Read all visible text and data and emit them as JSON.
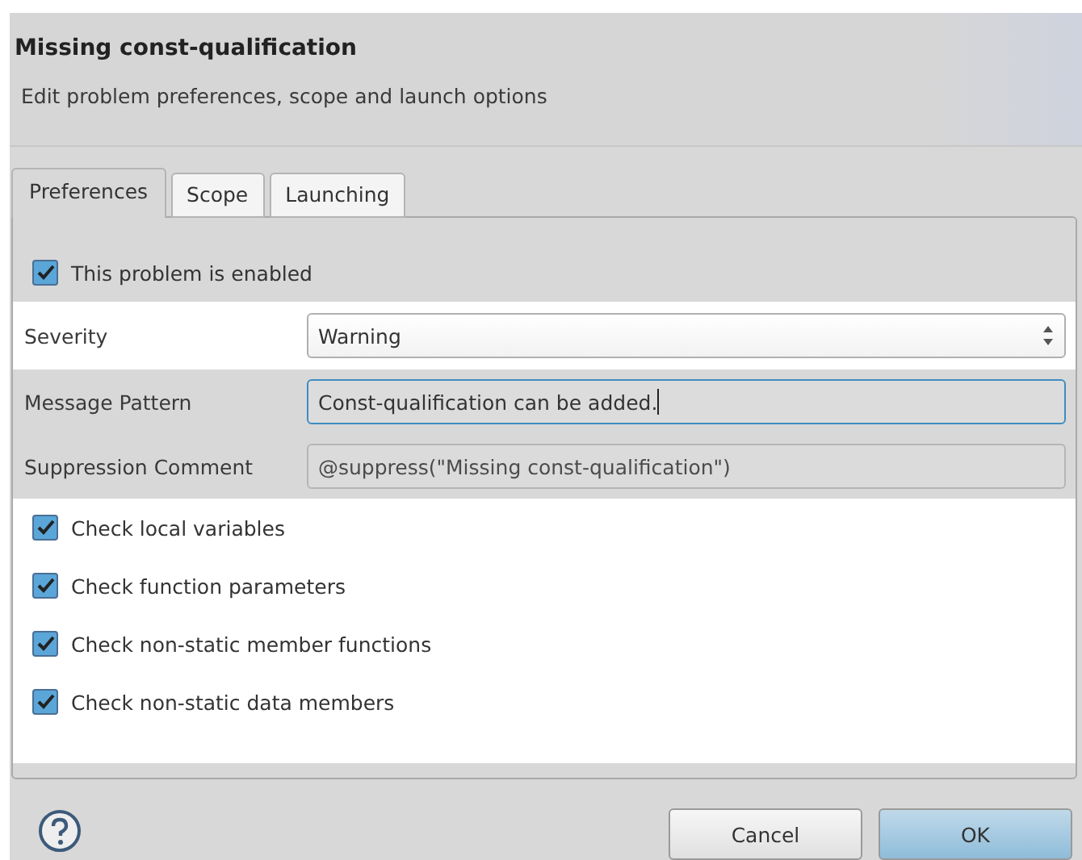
{
  "dialog": {
    "title": "Missing const-qualification",
    "subtitle": "Edit problem preferences, scope and launch options"
  },
  "tabs": [
    {
      "label": "Preferences",
      "selected": true
    },
    {
      "label": "Scope",
      "selected": false
    },
    {
      "label": "Launching",
      "selected": false
    }
  ],
  "enabled": {
    "label": "This problem is enabled",
    "checked": true
  },
  "fields": [
    {
      "kind": "select",
      "label": "Severity",
      "value": "Warning",
      "focused": false,
      "disabled": false
    },
    {
      "kind": "text",
      "label": "Message Pattern",
      "value": "Const-qualification can be added.",
      "focused": true,
      "disabled": false
    },
    {
      "kind": "text",
      "label": "Suppression Comment",
      "value": "@suppress(\"Missing const-qualification\")",
      "focused": false,
      "disabled": true
    }
  ],
  "options": [
    {
      "label": "Check local variables",
      "checked": true
    },
    {
      "label": "Check function parameters",
      "checked": true
    },
    {
      "label": "Check non-static member functions",
      "checked": true
    },
    {
      "label": "Check non-static data members",
      "checked": true
    }
  ],
  "buttons": [
    {
      "label": "Cancel",
      "kind": "secondary"
    },
    {
      "label": "OK",
      "kind": "primary"
    }
  ]
}
